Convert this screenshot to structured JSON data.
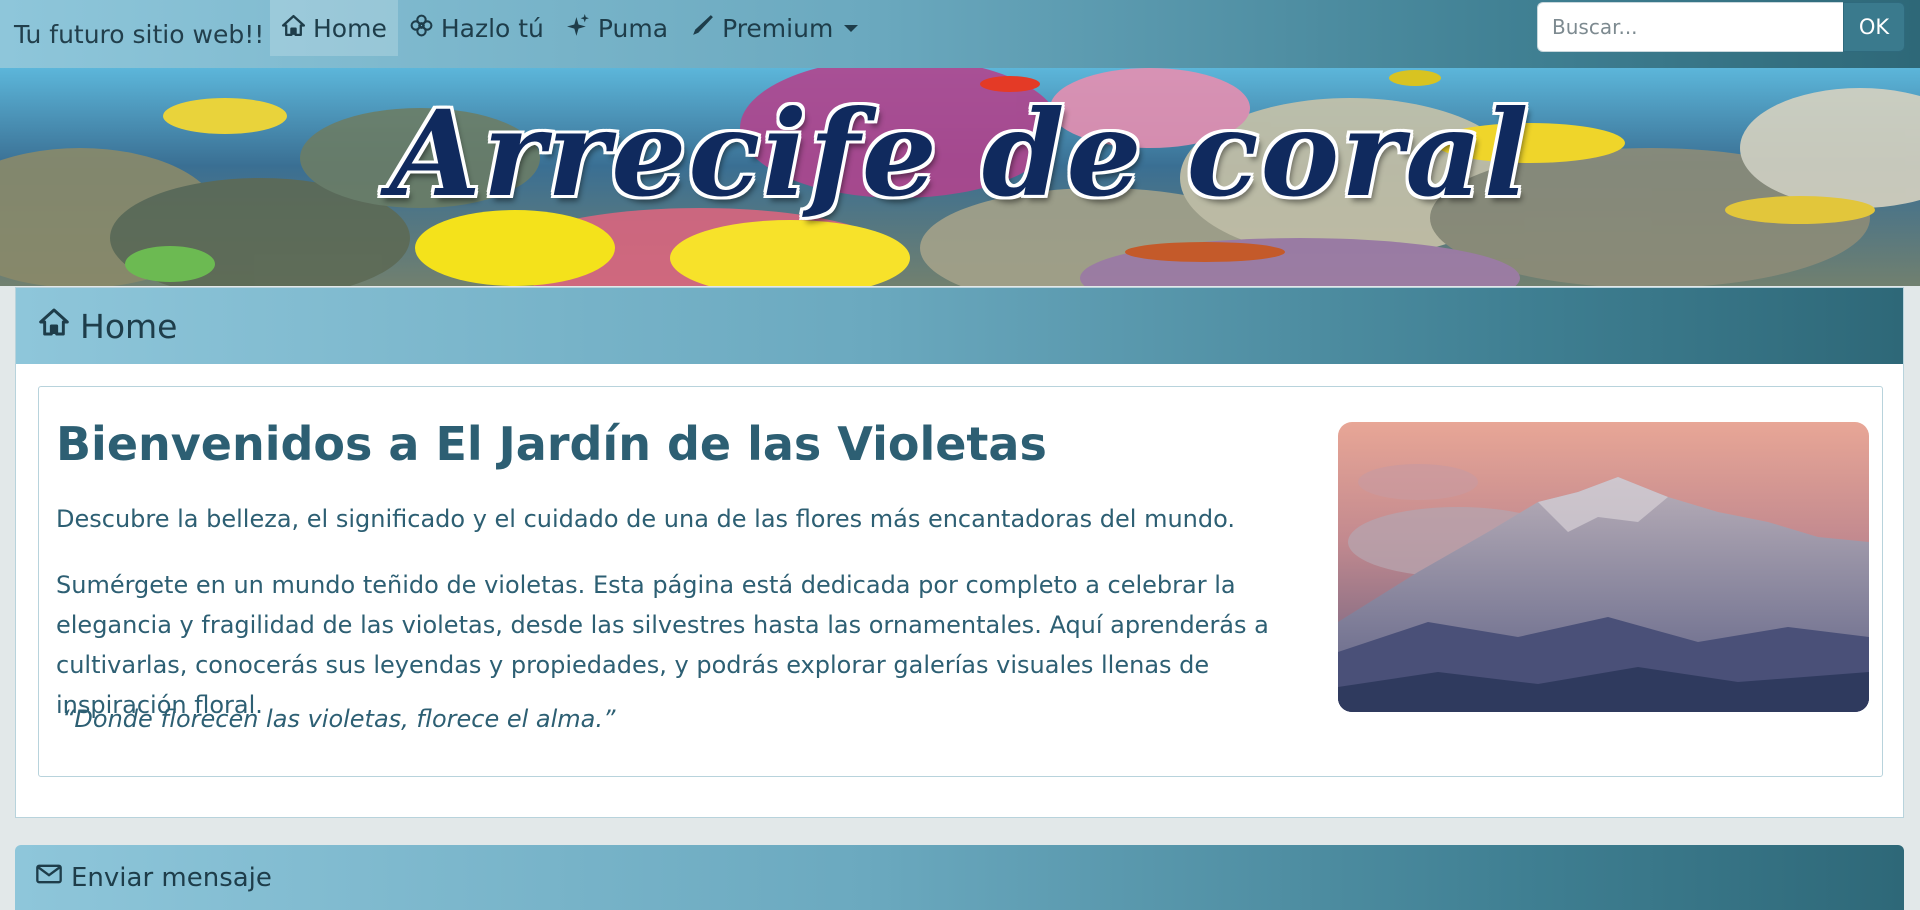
{
  "navbar": {
    "brand": "Tu futuro sitio web!!",
    "items": [
      {
        "label": "Home",
        "icon": "house-icon",
        "active": true
      },
      {
        "label": "Hazlo tú",
        "icon": "flower-icon"
      },
      {
        "label": "Puma",
        "icon": "sparkles-icon"
      },
      {
        "label": "Premium",
        "icon": "pencil-icon",
        "dropdown": true
      }
    ],
    "search": {
      "placeholder": "Buscar...",
      "button": "OK"
    }
  },
  "banner": {
    "title": "Arrecife de coral"
  },
  "home_card": {
    "header": "Home",
    "heading": "Bienvenidos a El Jardín de las Violetas",
    "lead": "Descubre la belleza, el significado y el cuidado de una de las flores más encantadoras del mundo.",
    "paragraph": "Sumérgete en un mundo teñido de violetas. Esta página está dedicada por completo a celebrar la elegancia y fragilidad de las violetas, desde las silvestres hasta las ornamentales. Aquí aprenderás a cultivarlas, conocerás sus leyendas y propiedades, y podrás explorar galerías visuales llenas de inspiración floral.",
    "quote": "“Donde florecen las violetas, florece el alma.”"
  },
  "message_card": {
    "header": "Enviar mensaje",
    "icon": "envelope-icon"
  },
  "colors": {
    "nav_gradient_start": "#8ec6da",
    "nav_gradient_end": "#2e6878",
    "text": "#2d5f73",
    "banner_title": "#102a5e"
  }
}
